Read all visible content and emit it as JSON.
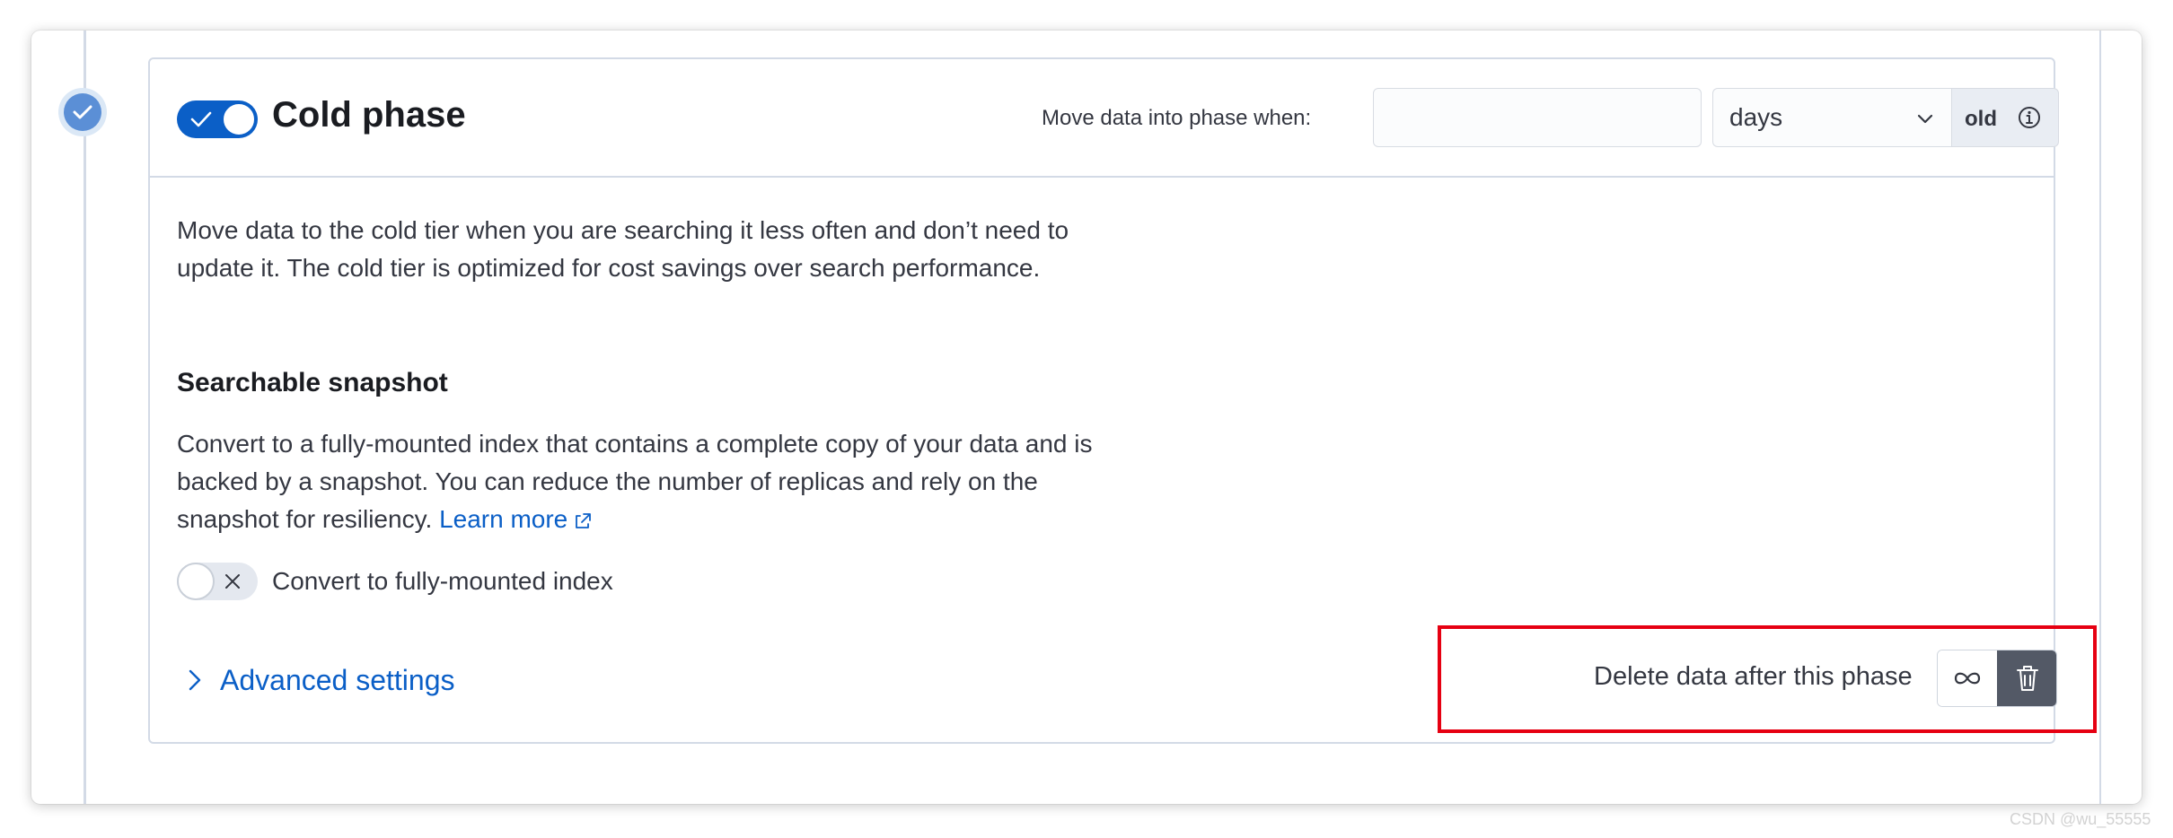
{
  "phase": {
    "title": "Cold phase",
    "enabled": true,
    "move_label": "Move data into phase when:",
    "age_value": "",
    "unit_selected": "days",
    "unit_suffix": "old",
    "description": "Move data to the cold tier when you are searching it less often and don’t need to update it. The cold tier is optimized for cost savings over search performance."
  },
  "searchable_snapshot": {
    "title": "Searchable snapshot",
    "description": "Convert to a fully-mounted index that contains a complete copy of your data and is backed by a snapshot. You can reduce the number of replicas and rely on the snapshot for resiliency.",
    "learn_more": "Learn more",
    "toggle_label": "Convert to fully-mounted index",
    "toggle_enabled": false
  },
  "advanced_settings_label": "Advanced settings",
  "delete_after_label": "Delete data after this phase",
  "watermark": "CSDN @wu_55555",
  "colors": {
    "accent": "#0b5fc7",
    "highlight_box": "#e60012",
    "step_check": "#5b8fd6"
  },
  "icons": {
    "step": "check-circle-icon",
    "unit_dropdown": "chevron-down-icon",
    "info": "info-icon",
    "external_link": "external-link-icon",
    "toggle_off": "cross-icon",
    "advanced": "chevron-right-icon",
    "keep_forever": "infinity-icon",
    "delete": "trash-icon"
  }
}
